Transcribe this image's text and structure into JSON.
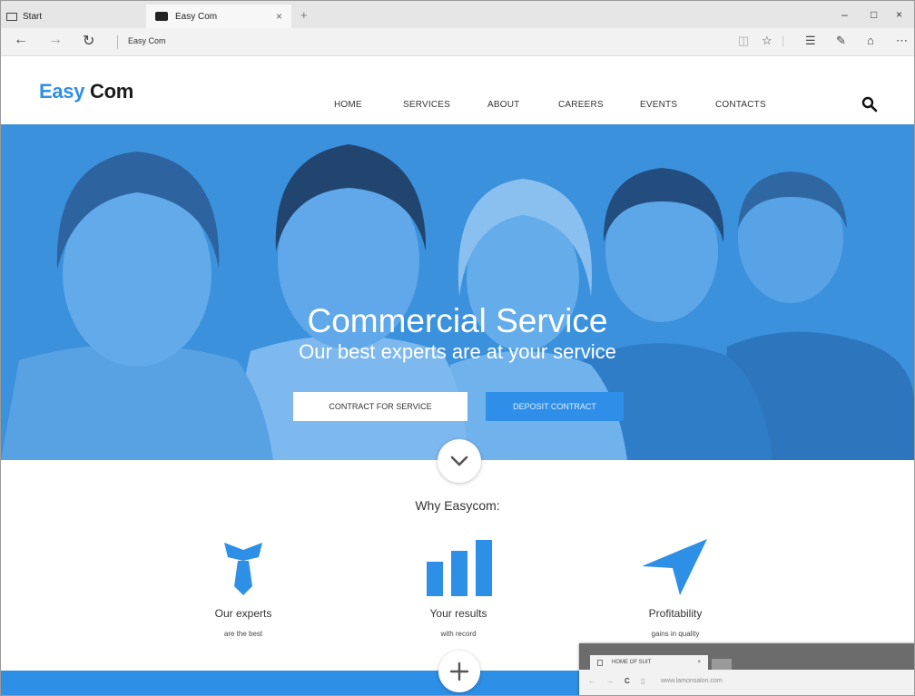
{
  "browser": {
    "tabs": [
      {
        "label": "Start"
      },
      {
        "label": "Easy Com"
      }
    ],
    "new_tab_symbol": "+",
    "tab_close_symbol": "×",
    "window_controls": {
      "minimize": "–",
      "maximize": "□",
      "close": "×"
    },
    "nav": {
      "back": "←",
      "forward": "→",
      "refresh": "↻"
    },
    "address": "Easy Com",
    "toolbar_icons": [
      "reading-view-icon",
      "favorite-star-icon",
      "hub-icon",
      "web-note-icon",
      "share-icon",
      "more-icon"
    ]
  },
  "site": {
    "logo": {
      "part1": "Easy",
      "part2": "Com",
      "accent": "#2e8fe6"
    },
    "menu": [
      "HOME",
      "SERVICES",
      "ABOUT",
      "CAREERS",
      "EVENTS",
      "CONTACTS"
    ]
  },
  "hero": {
    "title": "Commercial Service",
    "subtitle": "Our best experts are at your service",
    "btn_primary": "CONTRACT FOR SERVICE",
    "btn_secondary": "DEPOSIT CONTRACT",
    "overlay_color": "#3b92dc"
  },
  "why": {
    "title": "Why Easycom:",
    "features": [
      {
        "icon": "tie-icon",
        "title": "Our experts",
        "sub": "are the best"
      },
      {
        "icon": "bar-chart-icon",
        "title": "Your results",
        "sub": "with record"
      },
      {
        "icon": "paper-plane-icon",
        "title": "Profitability",
        "sub": "gains in quality"
      }
    ]
  },
  "overlay_screenshot": {
    "tab": "HOME OF SUIT",
    "url": "www.lamonsalon.com"
  }
}
